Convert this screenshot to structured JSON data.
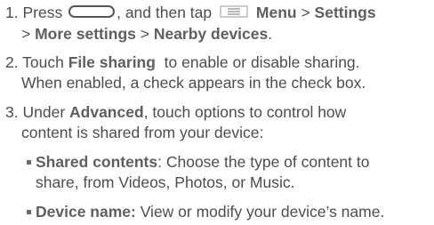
{
  "steps": [
    {
      "number": "1.",
      "line1": {
        "press": "Press",
        "middle": ", and then tap",
        "menu": "Menu",
        "sep1": " > ",
        "settings": "Settings"
      },
      "line2": {
        "sep0": "> ",
        "more_settings": "More settings",
        "sep1": " > ",
        "nearby_devices": "Nearby devices",
        "end": "."
      },
      "home_key_icon": "home-key-icon",
      "menu_icon": "menu-icon"
    },
    {
      "number": "2.",
      "line1": {
        "pre": "Touch ",
        "file_sharing": "File sharing",
        "post": "  to enable or disable sharing."
      },
      "line2": "When enabled, a check appears in the check box."
    },
    {
      "number": "3.",
      "line1": {
        "pre": "Under ",
        "advanced": "Advanced",
        "post": ", touch options to control how"
      },
      "line2": "content is shared from your device:",
      "bullets": [
        {
          "term": "Shared contents",
          "line1": ": Choose the type of content to",
          "line2": "share, from Videos, Photos, or Music."
        },
        {
          "term": "Device name:",
          "line1": " View or modify your device’s name."
        }
      ]
    }
  ],
  "colors": {
    "text": "#4d4d4d",
    "bold": "#5f5f5f"
  }
}
